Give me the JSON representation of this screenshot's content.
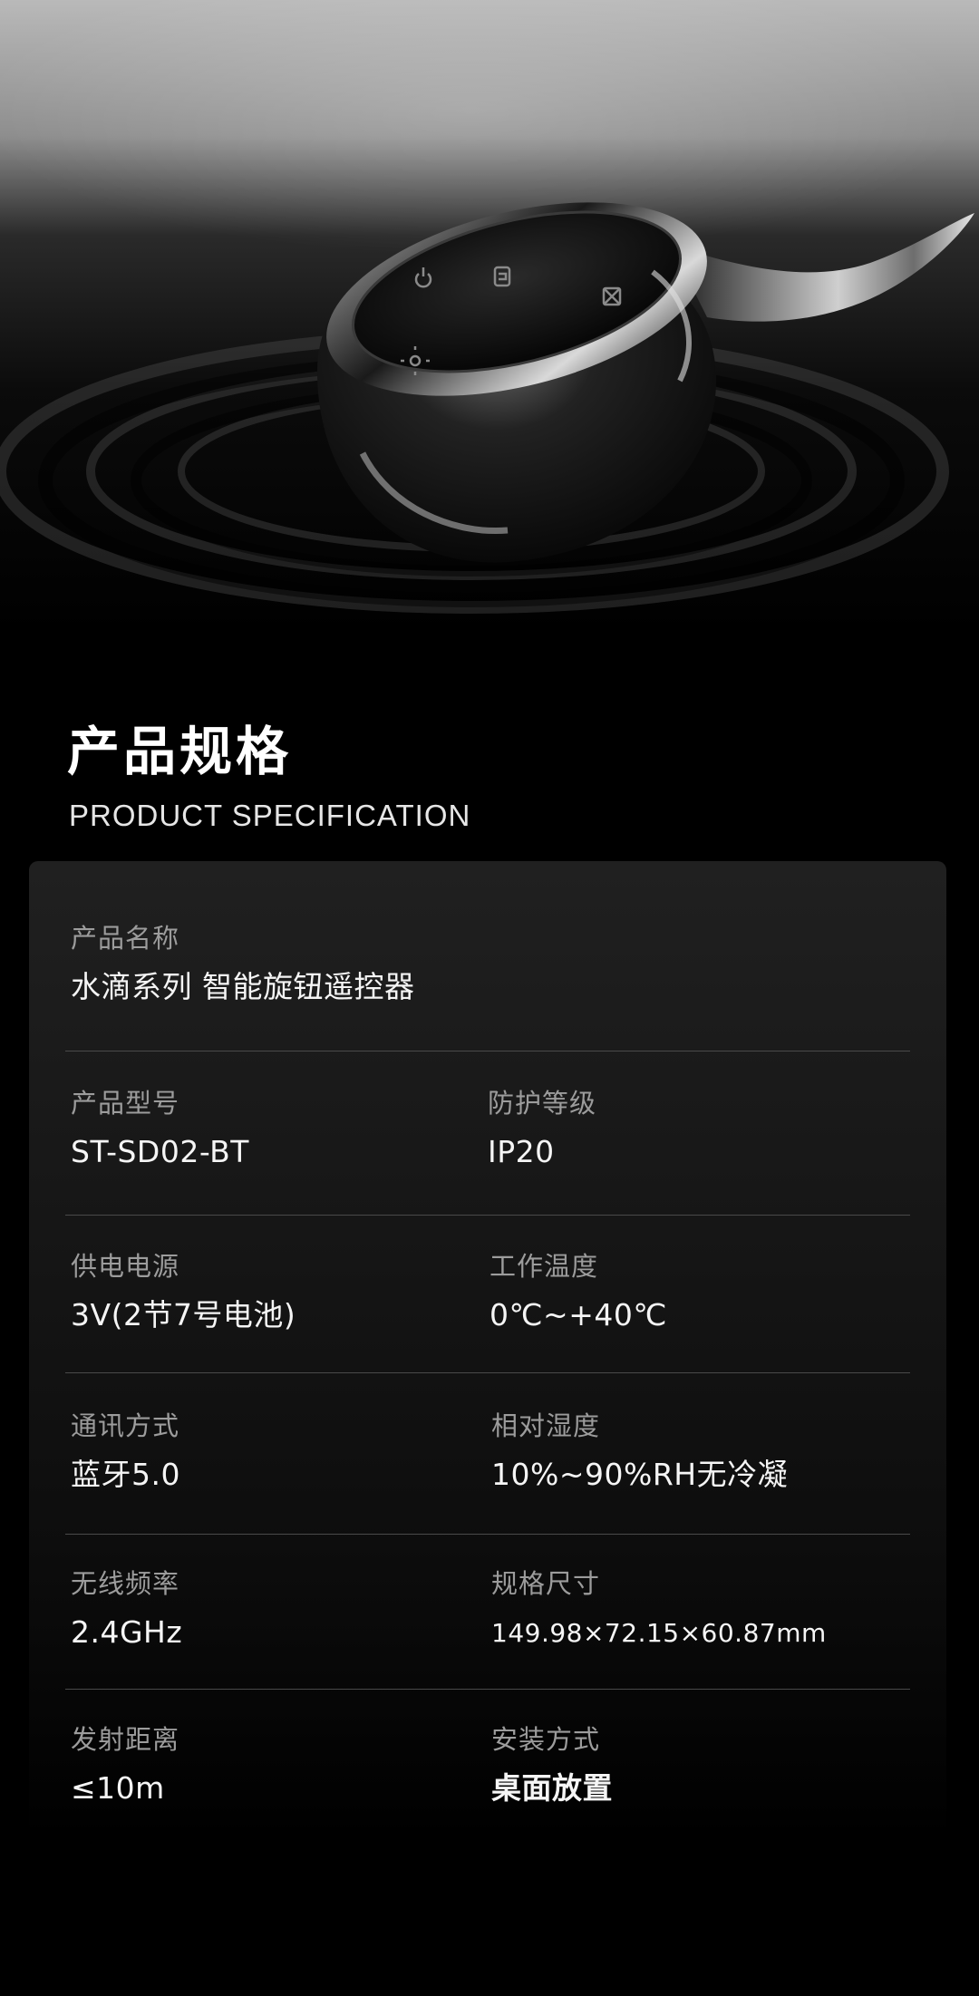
{
  "hero": {
    "knob_icons": [
      "power-icon",
      "mode-icon",
      "scene-icon",
      "light-icon"
    ]
  },
  "header": {
    "title_cn": "产品规格",
    "title_en": "PRODUCT SPECIFICATION"
  },
  "specs": {
    "name": {
      "label": "产品名称",
      "value": "水滴系列 智能旋钮遥控器"
    },
    "model": {
      "label": "产品型号",
      "value": "ST-SD02-BT"
    },
    "protection": {
      "label": "防护等级",
      "value": "IP20"
    },
    "power": {
      "label": "供电电源",
      "value": "3V(2节7号电池)"
    },
    "temperature": {
      "label": "工作温度",
      "value": "0℃~+40℃"
    },
    "communication": {
      "label": "通讯方式",
      "value": "蓝牙5.0"
    },
    "humidity": {
      "label": "相对湿度",
      "value": "10%~90%RH无冷凝"
    },
    "frequency": {
      "label": "无线频率",
      "value": "2.4GHz"
    },
    "dimensions": {
      "label": "规格尺寸",
      "value": "149.98×72.15×60.87mm"
    },
    "range": {
      "label": "发射距离",
      "value": "≤10m"
    },
    "installation": {
      "label": "安装方式",
      "value": "桌面放置"
    }
  },
  "colors": {
    "background": "#000000",
    "panel": "#1c1c1c",
    "label": "#9c9c9c",
    "value": "#f5f5f5",
    "divider": "#4a4a4a"
  }
}
